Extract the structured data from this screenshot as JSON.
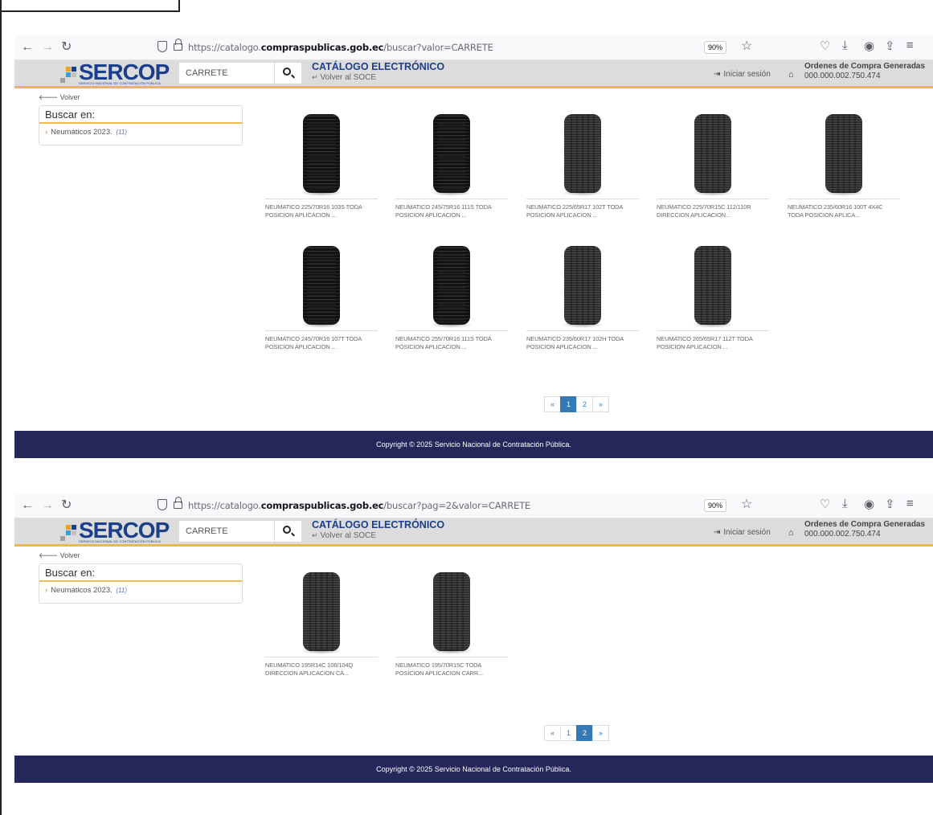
{
  "browser": {
    "url_prefix_1": "https://catalogo.",
    "url_domain_1": "compraspublicas.gob.ec",
    "url_path_1": "/buscar?valor=CARRETE",
    "url_prefix_2": "https://catalogo.",
    "url_domain_2": "compraspublicas.gob.ec",
    "url_path_2": "/buscar?pag=2&valor=CARRETE",
    "zoom": "90%",
    "nav_icons": [
      "back-arrow-icon",
      "forward-arrow-icon",
      "reload-icon"
    ],
    "toolbar_icons": [
      "pocket-icon",
      "download-icon",
      "account-icon",
      "extensions-icon",
      "menu-icon"
    ]
  },
  "site": {
    "logo_text": "SERCOP",
    "logo_sub": "SERVICIO NACIONAL DE CONTRATACIÓN PÚBLICA",
    "search_value": "CARRETE",
    "catalog_title": "CATÁLOGO ELECTRÓNICO",
    "back_soce": "Volver al SOCE",
    "login": "Iniciar sesión",
    "orders_title": "Ordenes de Compra Generadas",
    "orders_value": "000.000.002.750.474",
    "accent_color": "#e9b94a",
    "brand_color": "#1b3f8b"
  },
  "sidebar": {
    "volver": "Volver",
    "heading": "Buscar en:",
    "category": "Neumáticos 2023.",
    "category_count": "(11)"
  },
  "page1": {
    "products": [
      {
        "line1": "NEUMATICO 225/70R16 103S TODA",
        "line2": "POSICION APLICACION ..."
      },
      {
        "line1": "NEUMATICO 245/75R16 111S TODA",
        "line2": "POSICION APLICACION ..."
      },
      {
        "line1": "NEUMATICO 225/65R17 102T TODA",
        "line2": "POSICION APLICACION ..."
      },
      {
        "line1": "NEUMATICO 225/70R15C 112/110R",
        "line2": "DIRECCION APLICACION..."
      },
      {
        "line1": "NEUMATICO 235/60R16 100T 4X4C",
        "line2": "TODA POSICION APLICA..."
      },
      {
        "line1": "NEUMATICO 245/70R16 107T TODA",
        "line2": "POSICION APLICACION ..."
      },
      {
        "line1": "NEUMATICO 255/70R16 111S TODA",
        "line2": "POSICION APLICACION ..."
      },
      {
        "line1": "NEUMATICO 235/60R17 102H TODA",
        "line2": "POSICION APLICACION ..."
      },
      {
        "line1": "NEUMATICO 265/65R17 112T TODA",
        "line2": "POSICION APLICACION ..."
      }
    ],
    "pager": [
      "«",
      "1",
      "2",
      "»"
    ],
    "active_page": "1"
  },
  "page2": {
    "products": [
      {
        "line1": "NEUMATICO 195R14C 106/104Q",
        "line2": "DIRECCION APLICACION CA..."
      },
      {
        "line1": "NEUMATICO 195/70R15C TODA",
        "line2": "POSICION APLICACION CARR..."
      }
    ],
    "pager": [
      "«",
      "1",
      "2",
      "»"
    ],
    "active_page": "2"
  },
  "footer": {
    "copyright": "Copyright © 2025 Servicio Nacional de Contratación Pública."
  }
}
